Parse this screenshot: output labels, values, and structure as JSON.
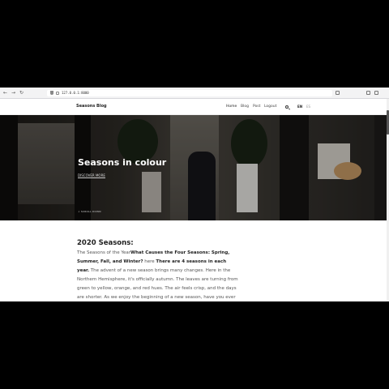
{
  "browser": {
    "back": "←",
    "forward": "→",
    "reload": "↻",
    "url": "127.0.0.1:8000"
  },
  "site": {
    "brand": "Seasons Blog",
    "menu": [
      {
        "label": "Home"
      },
      {
        "label": "Blog"
      },
      {
        "label": "Post"
      },
      {
        "label": "Logout"
      }
    ],
    "lang_primary": "EN",
    "lang_secondary": "ES"
  },
  "hero": {
    "title": "Seasons in colour",
    "link": "DISCOVER MORE",
    "scroll": "↓ SCROLL DOWN"
  },
  "article": {
    "heading": "2020 Seasons:",
    "intro": "The Seasons of the Year",
    "bold1": "What Causes the Four Seasons: Spring, Summer, Fall, and Winter?",
    "here": " here ",
    "bold2": "There are 4 seasons in each year.",
    "body": " The advent of a new season brings many changes. Here in the Northern Hemisphere, it's officially autumn. The leaves are turning from green to yellow, orange, and red hues. The air feels crisp, and the days are shorter. As we enjoy the beginning of a new season, have you ever"
  }
}
